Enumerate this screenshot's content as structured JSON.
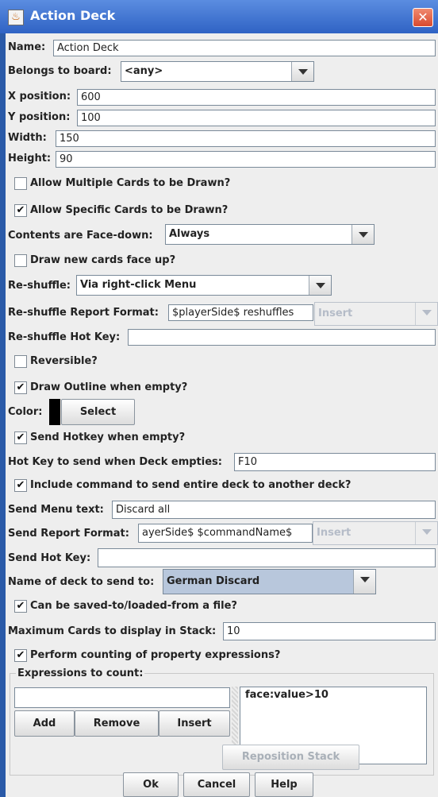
{
  "window": {
    "title": "Action Deck",
    "close_glyph": "✕",
    "icon_glyph": "♨"
  },
  "fields": {
    "name_label": "Name:",
    "name_value": "Action Deck",
    "board_label": "Belongs to board:",
    "board_value": "<any>",
    "x_label": "X position:",
    "x_value": "600",
    "y_label": "Y position:",
    "y_value": "100",
    "width_label": "Width:",
    "width_value": "150",
    "height_label": "Height:",
    "height_value": "90"
  },
  "options": {
    "allow_multiple": {
      "label": "Allow Multiple Cards to be Drawn?",
      "checked": false
    },
    "allow_specific": {
      "label": "Allow Specific Cards to be Drawn?",
      "checked": true
    },
    "facedown_label": "Contents are Face-down:",
    "facedown_value": "Always",
    "draw_face_up": {
      "label": "Draw new cards face up?",
      "checked": false
    },
    "reshuffle_label": "Re-shuffle:",
    "reshuffle_value": "Via right-click Menu",
    "reshuffle_report_label": "Re-shuffle Report Format:",
    "reshuffle_report_value": "$playerSide$ reshuffles",
    "insert_placeholder": "Insert",
    "reshuffle_hotkey_label": "Re-shuffle Hot Key:",
    "reshuffle_hotkey_value": "",
    "reversible": {
      "label": "Reversible?",
      "checked": false
    },
    "draw_outline": {
      "label": "Draw Outline when empty?",
      "checked": true
    },
    "color_label": "Color:",
    "color_value": "#000000",
    "select_label": "Select",
    "send_hotkey": {
      "label": "Send Hotkey when empty?",
      "checked": true
    },
    "hotkey_empty_label": "Hot Key to send when Deck empties:",
    "hotkey_empty_value": "F10",
    "include_command": {
      "label": "Include command to send entire deck to another deck?",
      "checked": true
    },
    "send_menu_label": "Send Menu text:",
    "send_menu_value": "Discard all",
    "send_report_label": "Send Report Format:",
    "send_report_value": "ayerSide$ $commandName$",
    "send_hotkey_label": "Send Hot Key:",
    "send_hotkey_value": "",
    "deck_to_label": "Name of deck to send to:",
    "deck_to_value": "German Discard",
    "saveable": {
      "label": "Can be saved-to/loaded-from a file?",
      "checked": true
    },
    "max_cards_label": "Maximum Cards to display in Stack:",
    "max_cards_value": "10",
    "counting": {
      "label": "Perform counting of property expressions?",
      "checked": true
    }
  },
  "expressions": {
    "group_title": "Expressions to count:",
    "input_value": "",
    "items": [
      "face:value>10"
    ],
    "add_label": "Add",
    "remove_label": "Remove",
    "insert_label": "Insert"
  },
  "footer": {
    "reposition_label": "Reposition Stack",
    "ok_label": "Ok",
    "cancel_label": "Cancel",
    "help_label": "Help"
  },
  "check_glyph": "✔"
}
